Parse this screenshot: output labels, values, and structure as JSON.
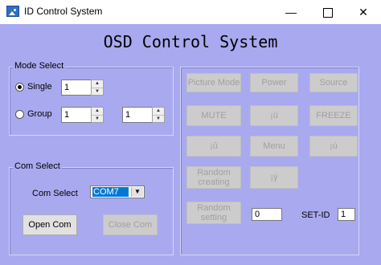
{
  "titlebar": {
    "title": "ID Control System",
    "minimize": "—",
    "close": "✕"
  },
  "heading": "OSD Control System",
  "mode_select": {
    "label": "Mode Select",
    "single_label": "Single",
    "single_value": "1",
    "group_label": "Group",
    "group_value_1": "1",
    "group_value_2": "1",
    "selected": "single"
  },
  "com_select": {
    "label": "Com Select",
    "field_label": "Com Select",
    "value": "COM7",
    "open_label": "Open Com",
    "close_label": "Close Com"
  },
  "controls": {
    "picture_mode": "Picture Mode",
    "power": "Power",
    "source": "Source",
    "mute": "MUTE",
    "up": "¡ü",
    "freeze": "FREEZE",
    "left": "¡û",
    "menu": "Menu",
    "right": "¡ú",
    "random_creating": "Random creating",
    "down": "¡ý",
    "random_setting": "Random setting",
    "random_value": "0",
    "set_id_label": "SET-ID",
    "set_id_value": "1"
  },
  "colors": {
    "window_bg": "#a9a9f0",
    "selection": "#0078d7"
  }
}
